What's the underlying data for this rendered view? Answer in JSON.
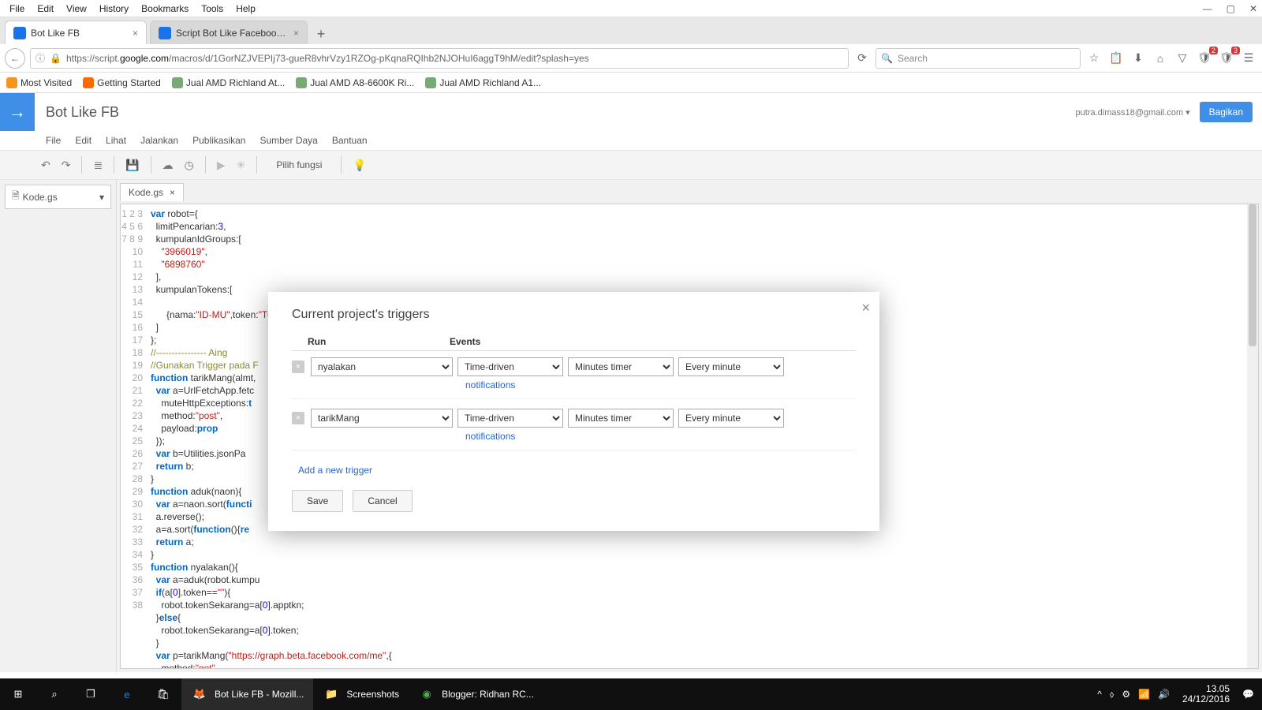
{
  "firefox_menu": [
    "File",
    "Edit",
    "View",
    "History",
    "Bookmarks",
    "Tools",
    "Help"
  ],
  "window_controls": {
    "min": "—",
    "max": "▢",
    "close": "✕"
  },
  "tabs": [
    {
      "title": "Bot Like FB",
      "active": true
    },
    {
      "title": "Script Bot Like Facebook -...",
      "active": false
    }
  ],
  "newtab": "+",
  "addr": {
    "back": "←",
    "info": "ⓘ",
    "lock": "🔒",
    "url_pre": "https://script.",
    "url_dom": "google.com",
    "url_rest": "/macros/d/1GorNZJVEPIj73-gueR8vhrVzy1RZOg-pKqnaRQIhb2NJOHuI6aggT9hM/edit?splash=yes",
    "reload": "⟳",
    "search_ph": "Search",
    "icons": {
      "star": "☆",
      "clip": "📋",
      "down": "⬇",
      "home": "⌂",
      "pocket": "▽",
      "menu": "☰"
    },
    "badge1": "2",
    "badge2": "3"
  },
  "bookmarks": [
    {
      "t": "Most Visited"
    },
    {
      "t": "Getting Started"
    },
    {
      "t": "Jual AMD Richland At..."
    },
    {
      "t": "Jual AMD A8-6600K Ri..."
    },
    {
      "t": "Jual AMD Richland A1..."
    }
  ],
  "gas": {
    "arrow": "→",
    "title": "Bot Like FB",
    "account": "putra.dimass18@gmail.com ▾",
    "share": "Bagikan",
    "menu": [
      "File",
      "Edit",
      "Lihat",
      "Jalankan",
      "Publikasikan",
      "Sumber Daya",
      "Bantuan"
    ],
    "tools": {
      "undo": "↶",
      "redo": "↷",
      "indent": "≣",
      "save": "💾",
      "cloud": "☁",
      "clock": "◷",
      "run": "▶",
      "bug": "✳",
      "func": "Pilih fungsi",
      "bulb": "💡"
    },
    "file": "Kode.gs",
    "filedrop": "▾",
    "tabclose": "×",
    "gutter": "1\n2\n3\n4\n5\n6\n7\n8\n9\n10\n11\n12\n13\n14\n15\n16\n17\n18\n19\n20\n21\n22\n23\n24\n25\n26\n27\n28\n29\n30\n31\n32\n33\n34\n35\n36\n37\n38"
  },
  "dialog": {
    "close": "×",
    "title": "Current project's triggers",
    "head_run": "Run",
    "head_ev": "Events",
    "rows": [
      {
        "run": "nyalakan",
        "ev": "Time-driven",
        "t1": "Minutes timer",
        "t2": "Every minute"
      },
      {
        "run": "tarikMang",
        "ev": "Time-driven",
        "t1": "Minutes timer",
        "t2": "Every minute"
      }
    ],
    "notif": "notifications",
    "add": "Add a new trigger",
    "save": "Save",
    "cancel": "Cancel",
    "del": "×"
  },
  "taskbar": {
    "items": [
      {
        "label": "",
        "icon": "⊞",
        "c": "#fff"
      },
      {
        "label": "",
        "icon": "⌕",
        "c": "#fff"
      },
      {
        "label": "",
        "icon": "❐",
        "c": "#fff"
      },
      {
        "label": "",
        "icon": "e",
        "c": "#2b7cd3"
      },
      {
        "label": "",
        "icon": "🛍",
        "c": "#fff"
      },
      {
        "label": "Bot Like FB - Mozill...",
        "icon": "🦊",
        "c": "#ff9500",
        "active": true
      },
      {
        "label": "Screenshots",
        "icon": "📁",
        "c": "#f7d774"
      },
      {
        "label": "Blogger: Ridhan RC...",
        "icon": "◉",
        "c": "#4caf50"
      }
    ],
    "tray": [
      "^",
      "⬨",
      "⚙",
      "📶",
      "🔊"
    ],
    "time": "13.05",
    "date": "24/12/2016",
    "notif": "💬"
  }
}
